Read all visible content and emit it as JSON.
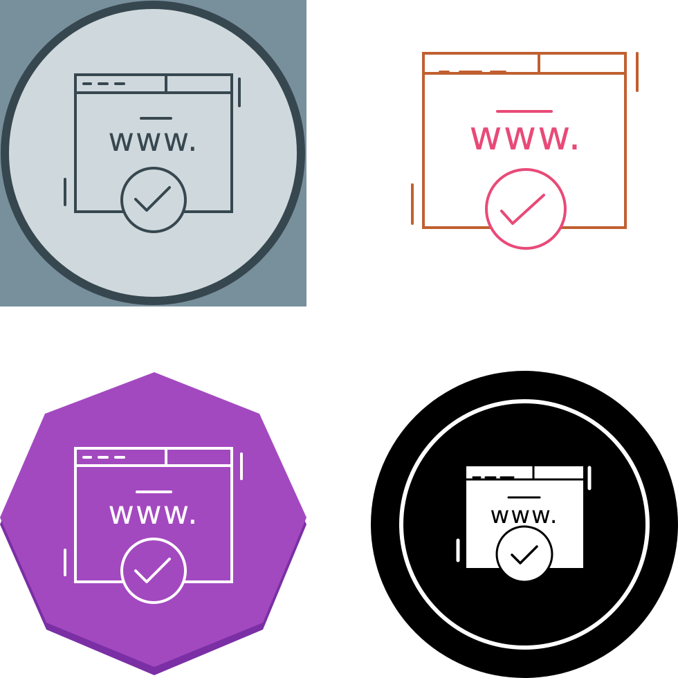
{
  "variants": [
    {
      "name": "line-style",
      "url_text": "www.",
      "colors": {
        "background": "#78909c",
        "circle_fill": "#cfd8dc",
        "circle_border": "#37474f",
        "stroke": "#37474f",
        "accent": "#37474f"
      },
      "icons": [
        "website-window-icon",
        "check-circle-icon"
      ]
    },
    {
      "name": "colored-outline-style",
      "url_text": "www.",
      "colors": {
        "background": "#ffffff",
        "stroke": "#c06030",
        "accent": "#e84a78"
      },
      "icons": [
        "website-window-icon",
        "check-circle-icon"
      ]
    },
    {
      "name": "octagon-style",
      "url_text": "www.",
      "colors": {
        "shape_fill": "#a349c0",
        "shape_shadow": "#7b2fa5",
        "stroke": "#ffffff",
        "accent": "#ffffff"
      },
      "icons": [
        "website-window-icon",
        "check-circle-icon"
      ]
    },
    {
      "name": "glyph-style",
      "url_text": "www.",
      "colors": {
        "circle_fill": "#000000",
        "ring": "#ffffff",
        "glyph": "#ffffff",
        "detail": "#000000"
      },
      "icons": [
        "website-window-icon",
        "check-circle-icon"
      ]
    }
  ]
}
